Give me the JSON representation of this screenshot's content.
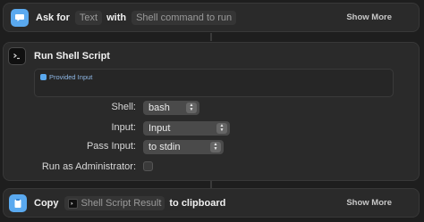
{
  "ask_action": {
    "title": "Ask for",
    "type_token": "Text",
    "with_word": "with",
    "prompt_placeholder": "Shell command to run",
    "show_more": "Show More"
  },
  "run_action": {
    "title": "Run Shell Script",
    "script_variable": "Provided Input",
    "fields": {
      "shell": {
        "label": "Shell:",
        "value": "bash"
      },
      "input": {
        "label": "Input:",
        "value": "Input"
      },
      "pass_input": {
        "label": "Pass Input:",
        "value": "to stdin"
      },
      "run_as_admin": {
        "label": "Run as Administrator:",
        "checked": false
      }
    }
  },
  "copy_action": {
    "title": "Copy",
    "variable": "Shell Script Result",
    "suffix": "to clipboard",
    "show_more": "Show More"
  },
  "colors": {
    "background": "#1e1e1e",
    "card": "#2a2a2a",
    "accent_blue": "#5aa9ef"
  }
}
